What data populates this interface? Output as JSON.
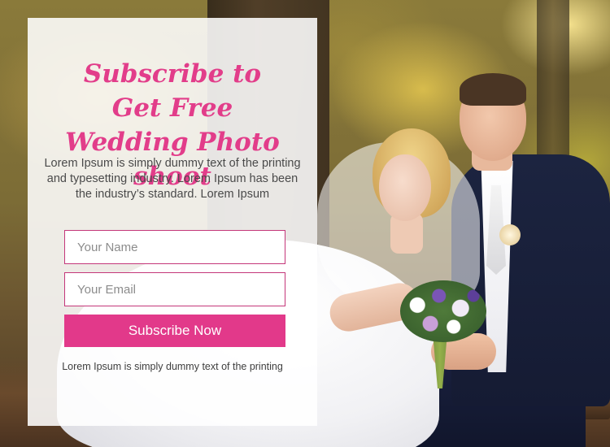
{
  "headline": "Subscribe to Get Free Wedding Photo shoot",
  "description": "Lorem Ipsum is simply dummy text of the printing and typesetting industry. Lorem Ipsum has been the industry’s standard. Lorem Ipsum",
  "form": {
    "name_placeholder": "Your Name",
    "email_placeholder": "Your Email",
    "submit_label": "Subscribe Now"
  },
  "footnote": "Lorem Ipsum is simply dummy text of the printing",
  "colors": {
    "accent": "#e2398a",
    "headline": "#e23d8a",
    "input_border": "#c4377a"
  }
}
